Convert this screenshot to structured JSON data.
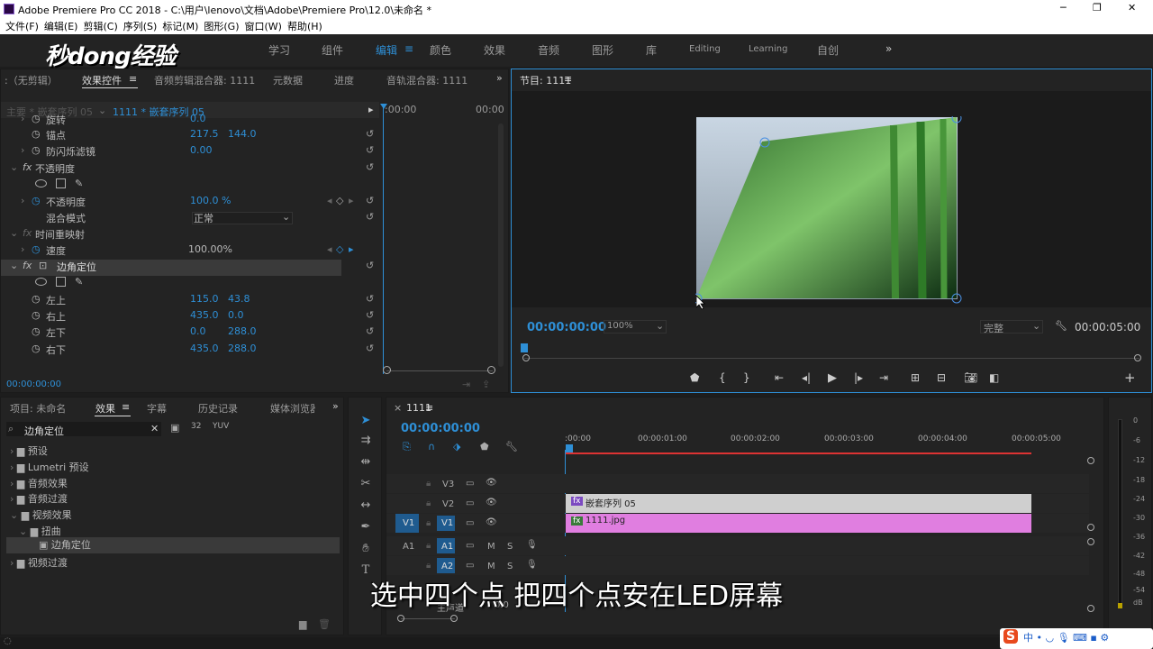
{
  "window": {
    "title": "Adobe Premiere Pro CC 2018 - C:\\用户\\lenovo\\文档\\Adobe\\Premiere Pro\\12.0\\未命名 *",
    "minimize": "─",
    "maximize": "❐",
    "close": "✕"
  },
  "menu": [
    "文件(F)",
    "编辑(E)",
    "剪辑(C)",
    "序列(S)",
    "标记(M)",
    "图形(G)",
    "窗口(W)",
    "帮助(H)"
  ],
  "logo": "秒dong经验",
  "workspaces": [
    "学习",
    "组件",
    "编辑",
    "颜色",
    "效果",
    "音频",
    "图形",
    "库",
    "Editing",
    "Learning",
    "自创"
  ],
  "ws_more": "»",
  "effect_controls": {
    "tabs": [
      ":（无剪辑）",
      "效果控件",
      "音频剪辑混合器: 1111",
      "元数据",
      "进度",
      "音轨混合器: 1111"
    ],
    "source": "主要 * 嵌套序列 05",
    "sequence_clip": "1111 * 嵌套序列 05",
    "time_start": ":00:00",
    "time_end": "00:00",
    "rows": [
      {
        "label": "旋转",
        "v1": "0.0",
        "v2": ""
      },
      {
        "label": "锚点",
        "v1": "217.5",
        "v2": "144.0"
      },
      {
        "label": "防闪烁滤镜",
        "v1": "0.00",
        "v2": ""
      }
    ],
    "opacity_section": "不透明度",
    "opacity_label": "不透明度",
    "opacity_value": "100.0 %",
    "blend_label": "混合模式",
    "blend_value": "正常",
    "timeremap_section": "时间重映射",
    "speed_label": "速度",
    "speed_value": "100.00%",
    "corner_section": "边角定位",
    "corners": [
      {
        "label": "左上",
        "x": "115.0",
        "y": "43.8"
      },
      {
        "label": "右上",
        "x": "435.0",
        "y": "0.0"
      },
      {
        "label": "左下",
        "x": "0.0",
        "y": "288.0"
      },
      {
        "label": "右下",
        "x": "435.0",
        "y": "288.0"
      }
    ],
    "timecode": "00:00:00:00"
  },
  "program": {
    "title": "节目: 1111",
    "timecode": "00:00:00:00",
    "zoom": "100%",
    "quality": "完整",
    "duration": "00:00:05:00"
  },
  "project": {
    "tabs": [
      "项目: 未命名",
      "效果",
      "字幕",
      "历史记录",
      "媒体浏览器"
    ],
    "search": "边角定位",
    "items": [
      {
        "label": "预设",
        "indent": 0
      },
      {
        "label": "Lumetri 预设",
        "indent": 0
      },
      {
        "label": "音频效果",
        "indent": 0
      },
      {
        "label": "音频过渡",
        "indent": 0
      },
      {
        "label": "视频效果",
        "indent": 0
      },
      {
        "label": "扭曲",
        "indent": 1
      },
      {
        "label": "边角定位",
        "indent": 2
      },
      {
        "label": "视频过渡",
        "indent": 0
      }
    ]
  },
  "timeline": {
    "title": "1111",
    "timecode": "00:00:00:00",
    "ruler": [
      ":00:00",
      "00:00:01:00",
      "00:00:02:00",
      "00:00:03:00",
      "00:00:04:00",
      "00:00:05:00"
    ],
    "tracks_video": [
      "V3",
      "V2",
      "V1"
    ],
    "tracks_audio": [
      "A1",
      "A2"
    ],
    "src_v1": "V1",
    "src_a1": "A1",
    "clip_nested": "嵌套序列 05",
    "clip_jpg": "1111.jpg",
    "master": "主声道",
    "master_value": "0.0",
    "meter": [
      "0",
      "-6",
      "-12",
      "-18",
      "-24",
      "-30",
      "-36",
      "-42",
      "-48",
      "-54",
      "dB"
    ]
  },
  "subtitle": "选中四个点 把四个点安在LED屏幕"
}
